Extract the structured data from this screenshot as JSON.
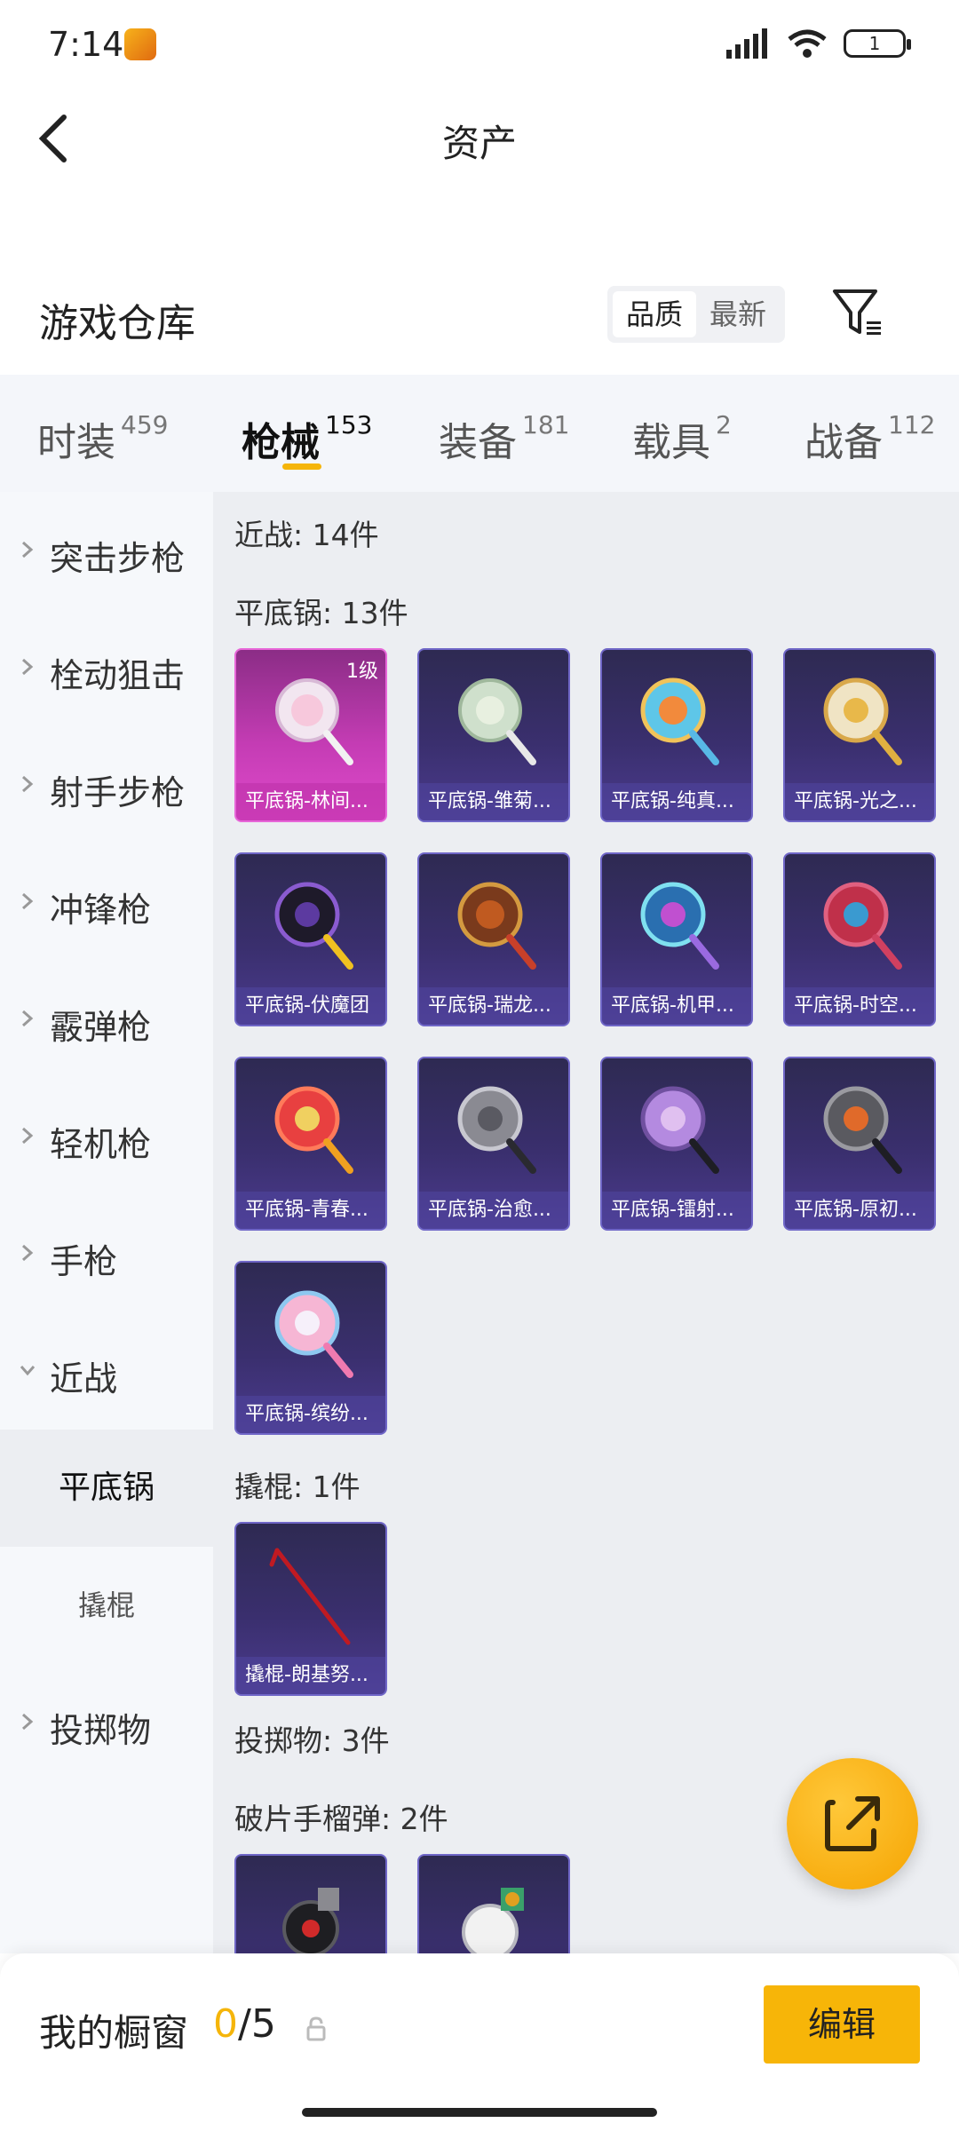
{
  "status": {
    "time": "7:14",
    "battery": "1"
  },
  "header": {
    "title": "资产"
  },
  "warehouse": {
    "title": "游戏仓库",
    "sort_options": [
      "品质",
      "最新"
    ]
  },
  "tabs": [
    {
      "label": "时装",
      "count": "459"
    },
    {
      "label": "枪械",
      "count": "153",
      "active": true
    },
    {
      "label": "装备",
      "count": "181"
    },
    {
      "label": "载具",
      "count": "2"
    },
    {
      "label": "战备",
      "count": "112"
    }
  ],
  "sidebar": {
    "items": [
      "突击步枪",
      "栓动狙击",
      "射手步枪",
      "冲锋枪",
      "霰弹枪",
      "轻机枪",
      "手枪",
      "近战"
    ],
    "subitems": [
      "平底锅",
      "撬棍"
    ],
    "last_item": "投掷物"
  },
  "content": {
    "melee_header": "近战: 14件",
    "pan_header": "平底锅: 13件",
    "pans": [
      {
        "name": "平底锅-林间...",
        "level": "1级"
      },
      {
        "name": "平底锅-雏菊..."
      },
      {
        "name": "平底锅-纯真..."
      },
      {
        "name": "平底锅-光之..."
      },
      {
        "name": "平底锅-伏魔团"
      },
      {
        "name": "平底锅-瑞龙..."
      },
      {
        "name": "平底锅-机甲..."
      },
      {
        "name": "平底锅-时空..."
      },
      {
        "name": "平底锅-青春..."
      },
      {
        "name": "平底锅-治愈..."
      },
      {
        "name": "平底锅-镭射..."
      },
      {
        "name": "平底锅-原初..."
      },
      {
        "name": "平底锅-缤纷..."
      }
    ],
    "crowbar_header": "撬棍: 1件",
    "crowbars": [
      {
        "name": "撬棍-朗基努..."
      }
    ],
    "throwable_header": "投掷物: 3件",
    "grenade_header": "破片手榴弹: 2件"
  },
  "bottom": {
    "label": "我的橱窗",
    "count_num": "0",
    "count_total": "/5",
    "edit_label": "编辑"
  }
}
